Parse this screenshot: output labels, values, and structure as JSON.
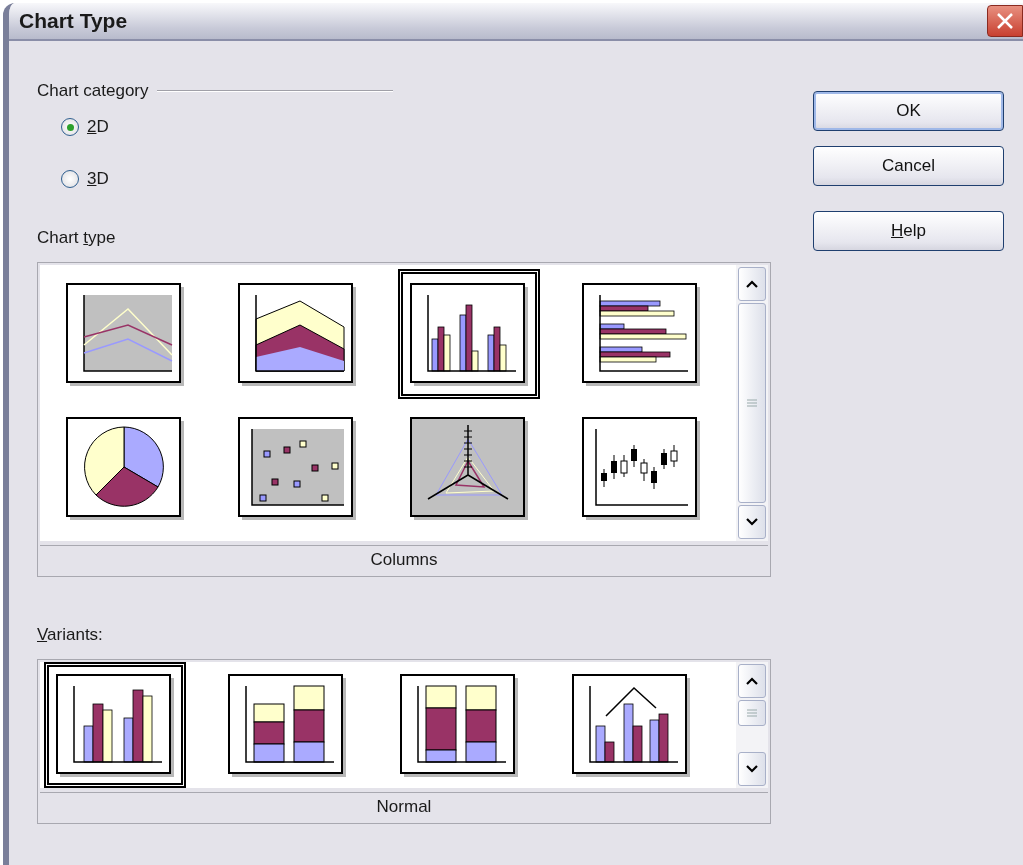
{
  "window": {
    "title": "Chart Type"
  },
  "chart_category": {
    "label": "Chart category",
    "options": [
      {
        "mnemonic": "2",
        "label_rest": "D",
        "selected": true
      },
      {
        "mnemonic": "3",
        "label_rest": "D",
        "selected": false
      }
    ]
  },
  "chart_type": {
    "label_start": "Chart ",
    "mnemonic": "t",
    "label_rest": "ype",
    "items": [
      {
        "kind": "line",
        "selected": false
      },
      {
        "kind": "area",
        "selected": false
      },
      {
        "kind": "column",
        "selected": true
      },
      {
        "kind": "bar",
        "selected": false
      },
      {
        "kind": "pie",
        "selected": false
      },
      {
        "kind": "xy",
        "selected": false
      },
      {
        "kind": "net",
        "selected": false
      },
      {
        "kind": "stock",
        "selected": false
      }
    ],
    "caption": "Columns"
  },
  "variants": {
    "mnemonic": "V",
    "label_rest": "ariants:",
    "items": [
      {
        "kind": "normal",
        "selected": true
      },
      {
        "kind": "stacked",
        "selected": false
      },
      {
        "kind": "percent",
        "selected": false
      },
      {
        "kind": "column-line",
        "selected": false
      }
    ],
    "caption": "Normal"
  },
  "buttons": [
    {
      "label": "OK",
      "kind": "default"
    },
    {
      "label": "Cancel",
      "kind": "plain"
    },
    {
      "mnemonic": "H",
      "label_rest": "elp",
      "kind": "help"
    }
  ]
}
